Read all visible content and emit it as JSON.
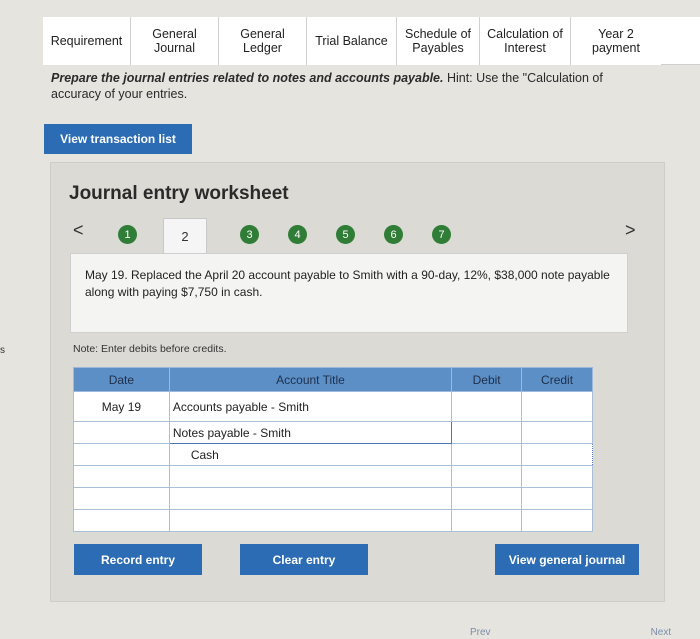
{
  "tabs": [
    {
      "label": "Requirement",
      "w": 88
    },
    {
      "label": "General\nJournal",
      "w": 88
    },
    {
      "label": "General\nLedger",
      "w": 88
    },
    {
      "label": "Trial Balance",
      "w": 90
    },
    {
      "label": "Schedule of\nPayables",
      "w": 83
    },
    {
      "label": "Calculation of\nInterest",
      "w": 91
    },
    {
      "label": "Year 2\npayment",
      "w": 90
    }
  ],
  "instruction": {
    "main": "Prepare the journal entries related to notes and accounts payable.",
    "hint": " Hint: Use the \"Calculation of",
    "line2": "accuracy of your entries."
  },
  "buttons": {
    "view_transaction_list": "View transaction list",
    "record_entry": "Record entry",
    "clear_entry": "Clear entry",
    "view_general_journal": "View general journal"
  },
  "worksheet": {
    "title": "Journal entry worksheet",
    "prev_arrow": "<",
    "next_arrow": ">",
    "steps": [
      "1",
      "2",
      "3",
      "4",
      "5",
      "6",
      "7"
    ],
    "active_step": "2",
    "description": "May 19. Replaced the April 20 account payable to Smith with a 90-day, 12%, $38,000 note payable along with paying $7,750 in cash.",
    "note": "Note: Enter debits before credits."
  },
  "table": {
    "headers": {
      "date": "Date",
      "account": "Account Title",
      "debit": "Debit",
      "credit": "Credit"
    },
    "rows": [
      {
        "date": "May 19",
        "account": "Accounts payable - Smith",
        "debit": "",
        "credit": ""
      },
      {
        "date": "",
        "account": "Notes payable - Smith",
        "debit": "",
        "credit": ""
      },
      {
        "date": "",
        "account": "Cash",
        "debit": "",
        "credit": ""
      },
      {
        "date": "",
        "account": "",
        "debit": "",
        "credit": ""
      },
      {
        "date": "",
        "account": "",
        "debit": "",
        "credit": ""
      },
      {
        "date": "",
        "account": "",
        "debit": "",
        "credit": ""
      }
    ]
  },
  "gutter": "s",
  "footer": {
    "prev": "Prev",
    "next": "Next"
  }
}
